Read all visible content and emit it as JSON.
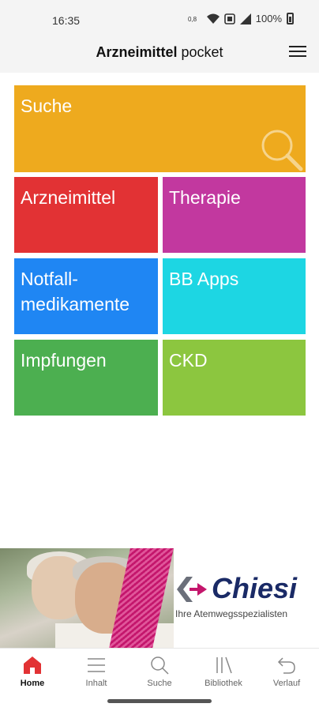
{
  "status_bar": {
    "time": "16:35",
    "battery": "100%"
  },
  "app_bar": {
    "title_bold": "Arzneimittel",
    "title_rest": " pocket"
  },
  "tiles": [
    {
      "id": "suche",
      "label": "Suche",
      "color": "#eeaa1e"
    },
    {
      "id": "arzneimittel",
      "label": "Arzneimittel",
      "color": "#e23234"
    },
    {
      "id": "therapie",
      "label": "Therapie",
      "color": "#c2389f"
    },
    {
      "id": "notfall",
      "label": "Notfall-\nmedikamente",
      "color": "#1f86f3"
    },
    {
      "id": "bbapps",
      "label": "BB Apps",
      "color": "#1dd6e3"
    },
    {
      "id": "impfungen",
      "label": "Impfungen",
      "color": "#4caf50"
    },
    {
      "id": "ckd",
      "label": "CKD",
      "color": "#8cc63f"
    }
  ],
  "banner": {
    "brand": "Chiesi",
    "tagline": "Ihre Atemwegsspezialisten"
  },
  "bottom_nav": [
    {
      "label": "Home",
      "icon": "home-icon",
      "active": true
    },
    {
      "label": "Inhalt",
      "icon": "list-icon"
    },
    {
      "label": "Suche",
      "icon": "search-icon"
    },
    {
      "label": "Bibliothek",
      "icon": "library-icon"
    },
    {
      "label": "Verlauf",
      "icon": "undo-icon"
    }
  ],
  "colors": {
    "accent_red": "#e23234",
    "brand_navy": "#1a2a66",
    "brand_magenta": "#c4166c"
  }
}
